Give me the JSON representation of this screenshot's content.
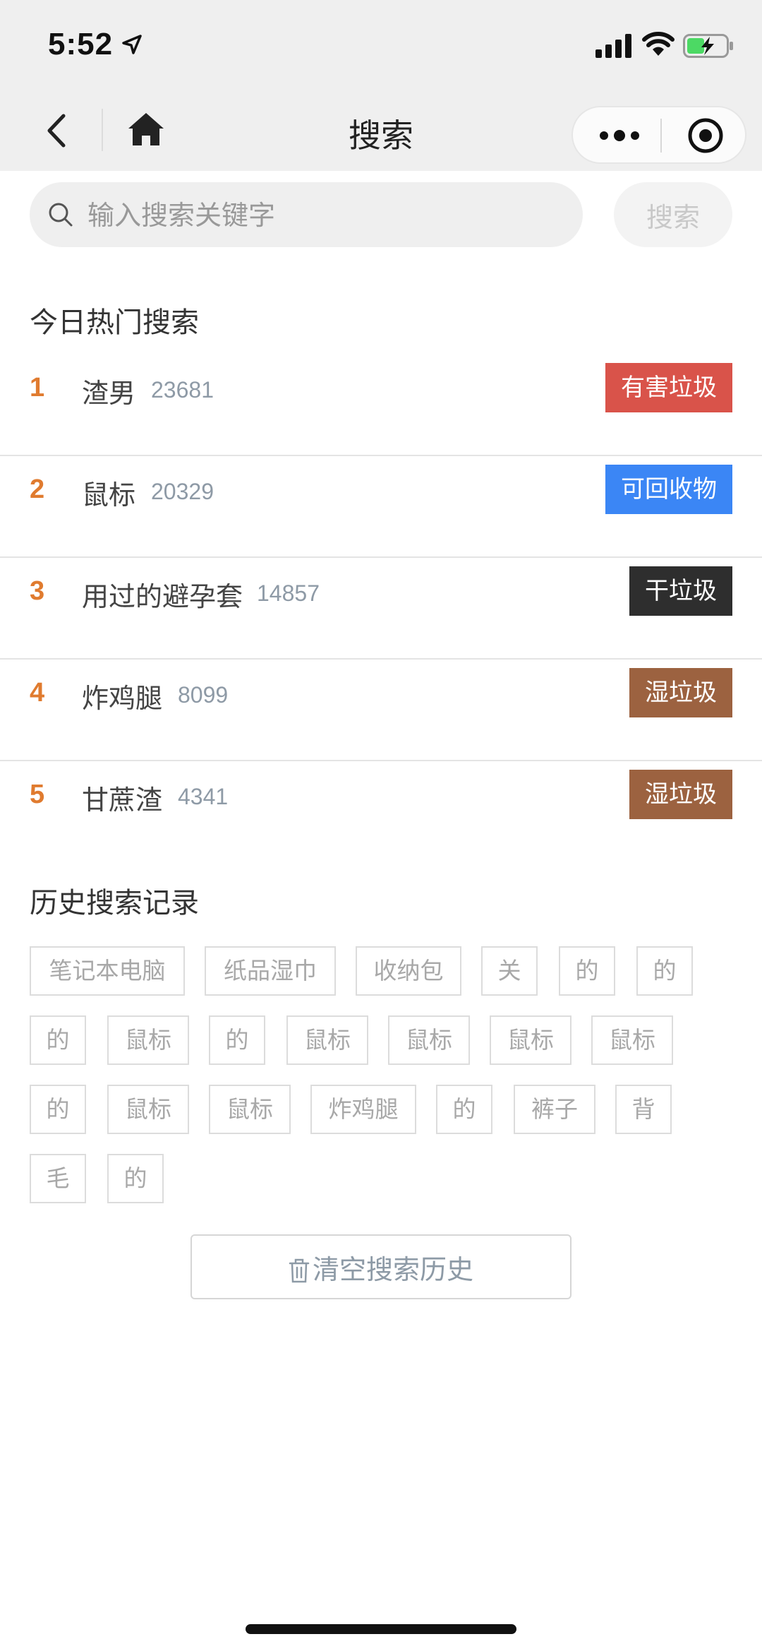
{
  "status_bar": {
    "time": "5:52",
    "icons": [
      "location-arrow-icon",
      "signal-icon",
      "wifi-icon",
      "battery-charging-icon"
    ]
  },
  "nav": {
    "title": "搜索",
    "back_icon": "chevron-left-icon",
    "home_icon": "home-icon",
    "menu_icons": [
      "more-dots-icon",
      "target-close-icon"
    ]
  },
  "search": {
    "placeholder": "输入搜索关键字",
    "value": "",
    "button_label": "搜索"
  },
  "hot": {
    "title": "今日热门搜索",
    "items": [
      {
        "rank": "1",
        "name": "渣男",
        "count": "23681",
        "tag": "有害垃圾",
        "tag_color": "#d9534a"
      },
      {
        "rank": "2",
        "name": "鼠标",
        "count": "20329",
        "tag": "可回收物",
        "tag_color": "#3b86f5"
      },
      {
        "rank": "3",
        "name": "用过的避孕套",
        "count": "14857",
        "tag": "干垃圾",
        "tag_color": "#2e2e2e"
      },
      {
        "rank": "4",
        "name": "炸鸡腿",
        "count": "8099",
        "tag": "湿垃圾",
        "tag_color": "#9c6240"
      },
      {
        "rank": "5",
        "name": "甘蔗渣",
        "count": "4341",
        "tag": "湿垃圾",
        "tag_color": "#9c6240"
      }
    ]
  },
  "history": {
    "title": "历史搜索记录",
    "tags": [
      "笔记本电脑",
      "纸品湿巾",
      "收纳包",
      "关",
      "的",
      "的",
      "的",
      "鼠标",
      "的",
      "鼠标",
      "鼠标",
      "鼠标",
      "鼠标",
      "的",
      "鼠标",
      "鼠标",
      "炸鸡腿",
      "的",
      "裤子",
      "背",
      "毛",
      "的"
    ],
    "clear_label": "清空搜索历史"
  },
  "colors": {
    "rank": "#e07b2f",
    "accent_red": "#d9534a",
    "accent_blue": "#3b86f5"
  }
}
